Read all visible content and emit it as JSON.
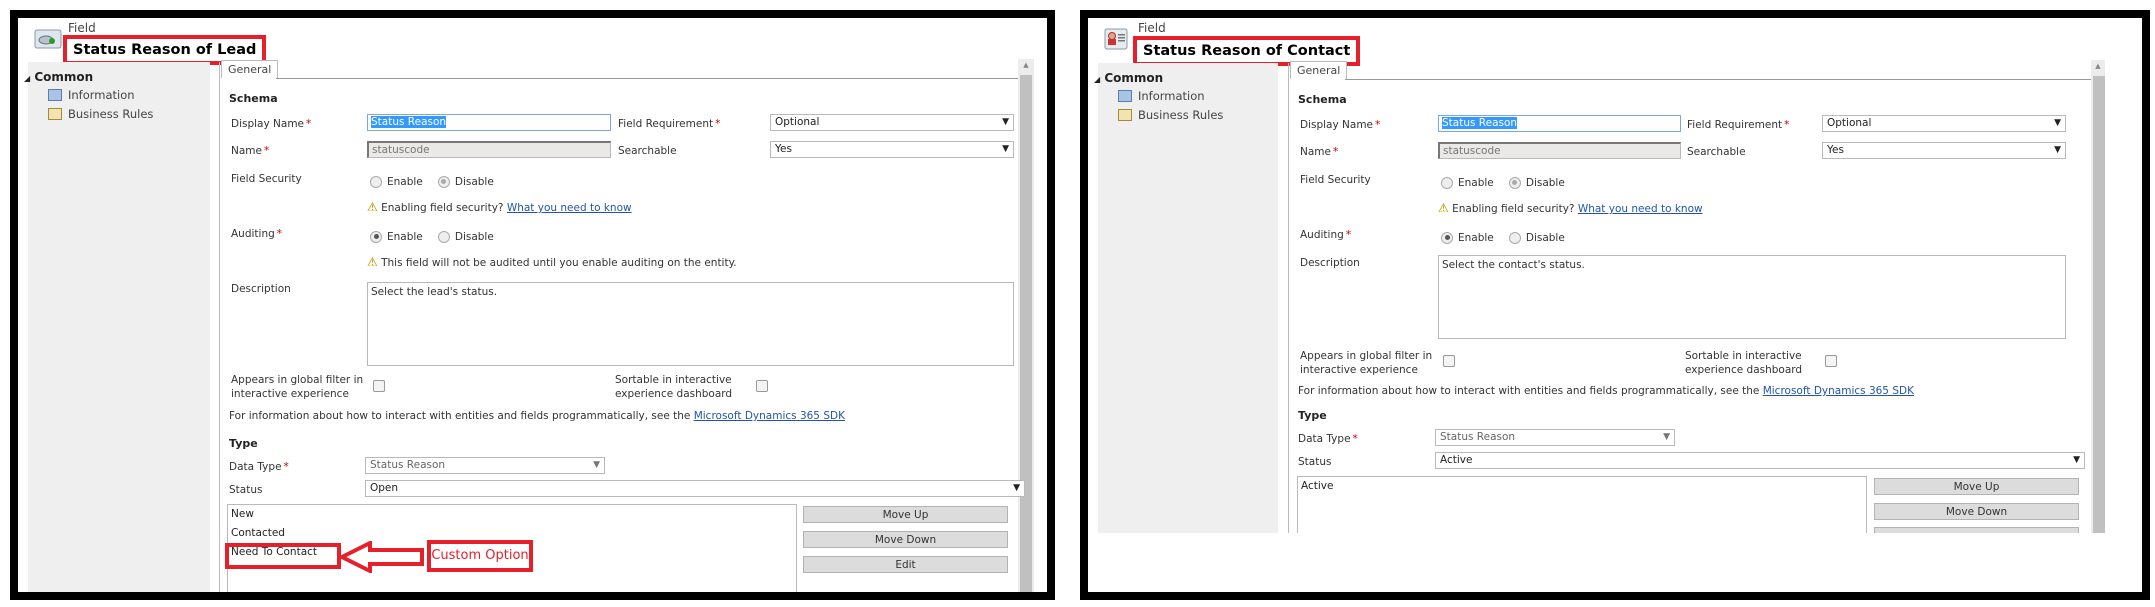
{
  "windows": [
    {
      "header": {
        "subtitle": "Field",
        "title": "Status Reason of Lead",
        "icon": "lead-entity-icon"
      },
      "nav": {
        "section": "Common",
        "items": [
          {
            "label": "Information",
            "icon": "information-icon"
          },
          {
            "label": "Business Rules",
            "icon": "business-rules-icon"
          }
        ]
      },
      "tab": "General",
      "schema": {
        "heading": "Schema",
        "display_name_label": "Display Name",
        "display_name_value": "Status Reason",
        "field_requirement_label": "Field Requirement",
        "field_requirement_value": "Optional",
        "name_label": "Name",
        "name_value": "statuscode",
        "searchable_label": "Searchable",
        "searchable_value": "Yes",
        "field_security_label": "Field Security",
        "enable_label": "Enable",
        "disable_label": "Disable",
        "security_warning": "Enabling field security?",
        "security_link": "What you need to know",
        "auditing_label": "Auditing",
        "auditing_warning": "This field will not be audited until you enable auditing on the entity.",
        "description_label": "Description",
        "description_value": "Select the lead's status.",
        "global_filter_label_1": "Appears in global filter in",
        "global_filter_label_2": "interactive experience",
        "sortable_label_1": "Sortable in interactive",
        "sortable_label_2": "experience dashboard",
        "sdk_text": "For information about how to interact with entities and fields programmatically, see the",
        "sdk_link": "Microsoft Dynamics 365 SDK"
      },
      "type": {
        "heading": "Type",
        "data_type_label": "Data Type",
        "data_type_value": "Status Reason",
        "status_label": "Status",
        "status_value": "Open",
        "options": [
          "New",
          "Contacted",
          "Need To Contact"
        ],
        "buttons": {
          "move_up": "Move Up",
          "move_down": "Move Down",
          "edit": "Edit"
        }
      },
      "annotation": {
        "callout": "Custom Option"
      }
    },
    {
      "header": {
        "subtitle": "Field",
        "title": "Status Reason of Contact",
        "icon": "contact-entity-icon"
      },
      "nav": {
        "section": "Common",
        "items": [
          {
            "label": "Information",
            "icon": "information-icon"
          },
          {
            "label": "Business Rules",
            "icon": "business-rules-icon"
          }
        ]
      },
      "tab": "General",
      "schema": {
        "heading": "Schema",
        "display_name_label": "Display Name",
        "display_name_value": "Status Reason",
        "field_requirement_label": "Field Requirement",
        "field_requirement_value": "Optional",
        "name_label": "Name",
        "name_value": "statuscode",
        "searchable_label": "Searchable",
        "searchable_value": "Yes",
        "field_security_label": "Field Security",
        "enable_label": "Enable",
        "disable_label": "Disable",
        "security_warning": "Enabling field security?",
        "security_link": "What you need to know",
        "auditing_label": "Auditing",
        "description_label": "Description",
        "description_value": "Select the contact's status.",
        "global_filter_label_1": "Appears in global filter in",
        "global_filter_label_2": "interactive experience",
        "sortable_label_1": "Sortable in interactive",
        "sortable_label_2": "experience dashboard",
        "sdk_text": "For information about how to interact with entities and fields programmatically, see the",
        "sdk_link": "Microsoft Dynamics 365 SDK"
      },
      "type": {
        "heading": "Type",
        "data_type_label": "Data Type",
        "data_type_value": "Status Reason",
        "status_label": "Status",
        "status_value": "Active",
        "options": [
          "Active"
        ],
        "buttons": {
          "move_up": "Move Up",
          "move_down": "Move Down"
        }
      }
    }
  ]
}
